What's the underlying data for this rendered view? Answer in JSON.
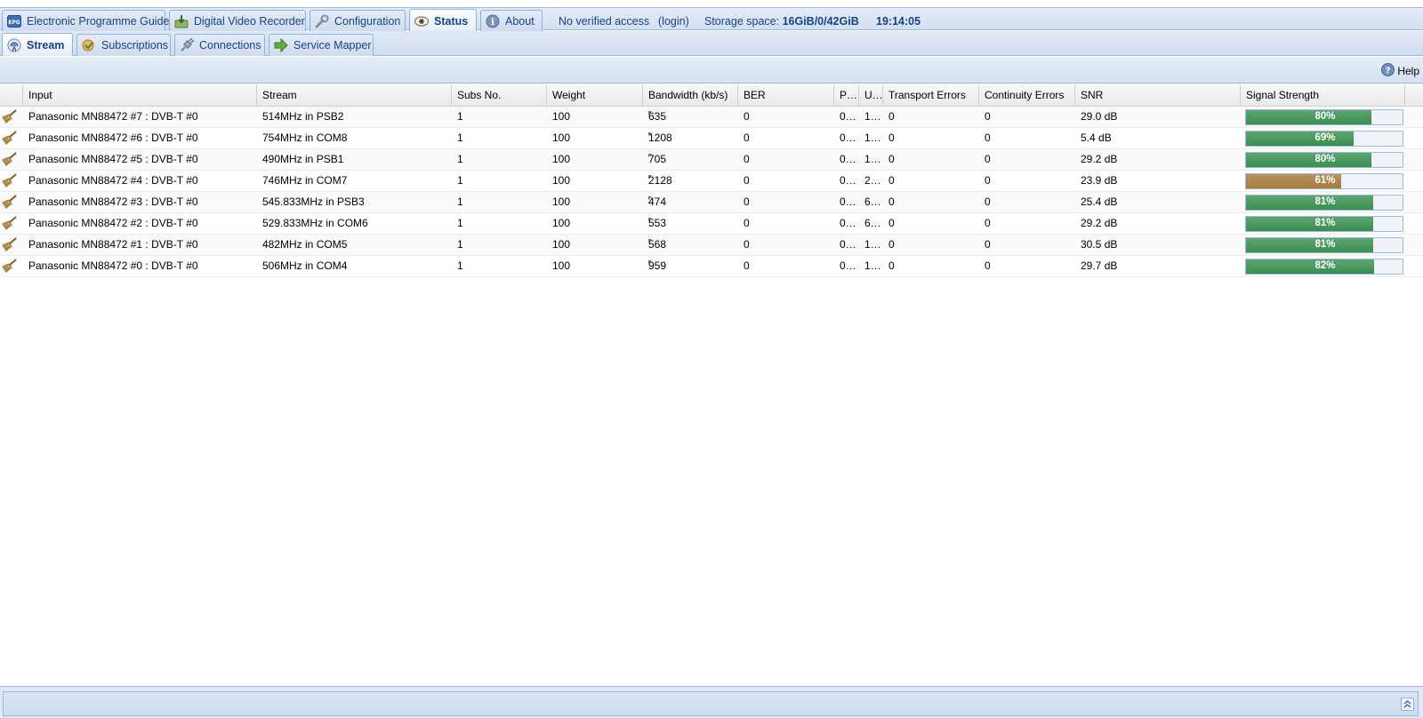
{
  "top_tabs": [
    {
      "label": "Electronic Programme Guide",
      "icon": "epg-icon",
      "active": false
    },
    {
      "label": "Digital Video Recorder",
      "icon": "dvr-icon",
      "active": false
    },
    {
      "label": "Configuration",
      "icon": "wrench-icon",
      "active": false
    },
    {
      "label": "Status",
      "icon": "eye-icon",
      "active": true
    },
    {
      "label": "About",
      "icon": "info-icon",
      "active": false
    }
  ],
  "header_info": {
    "access": "No verified access",
    "login": "(login)",
    "storage_label": "Storage space:",
    "storage_value": "16GiB/0/42GiB",
    "time": "19:14:05"
  },
  "sub_tabs": [
    {
      "label": "Stream",
      "icon": "antenna-icon",
      "active": true
    },
    {
      "label": "Subscriptions",
      "icon": "subscriptions-icon",
      "active": false
    },
    {
      "label": "Connections",
      "icon": "plug-icon",
      "active": false
    },
    {
      "label": "Service Mapper",
      "icon": "arrow-right-icon",
      "active": false
    }
  ],
  "toolbar": {
    "help_label": "Help"
  },
  "grid": {
    "columns": [
      "Input",
      "Stream",
      "Subs No.",
      "Weight",
      "Bandwidth (kb/s)",
      "BER",
      "P…",
      "U…",
      "Transport Errors",
      "Continuity Errors",
      "SNR",
      "Signal Strength"
    ],
    "rows": [
      {
        "input": "Panasonic MN88472 #7 : DVB-T #0",
        "stream": "514MHz in PSB2",
        "subs": "1",
        "weight": "100",
        "bandwidth": "635",
        "ber": "0",
        "p": "0…",
        "u": "1…",
        "transport": "0",
        "continuity": "0",
        "snr": "29.0 dB",
        "signal": 80,
        "signal_label": "80%",
        "signal_color": "#3a8f4f"
      },
      {
        "input": "Panasonic MN88472 #6 : DVB-T #0",
        "stream": "754MHz in COM8",
        "subs": "1",
        "weight": "100",
        "bandwidth": "1208",
        "ber": "0",
        "p": "0…",
        "u": "1…",
        "transport": "0",
        "continuity": "0",
        "snr": "5.4 dB",
        "signal": 69,
        "signal_label": "69%",
        "signal_color": "#3a8f4f"
      },
      {
        "input": "Panasonic MN88472 #5 : DVB-T #0",
        "stream": "490MHz in PSB1",
        "subs": "1",
        "weight": "100",
        "bandwidth": "705",
        "ber": "0",
        "p": "0…",
        "u": "1…",
        "transport": "0",
        "continuity": "0",
        "snr": "29.2 dB",
        "signal": 80,
        "signal_label": "80%",
        "signal_color": "#3a8f4f"
      },
      {
        "input": "Panasonic MN88472 #4 : DVB-T #0",
        "stream": "746MHz in COM7",
        "subs": "1",
        "weight": "100",
        "bandwidth": "2128",
        "ber": "0",
        "p": "0…",
        "u": "2…",
        "transport": "0",
        "continuity": "0",
        "snr": "23.9 dB",
        "signal": 61,
        "signal_label": "61%",
        "signal_color": "#a87a3c"
      },
      {
        "input": "Panasonic MN88472 #3 : DVB-T #0",
        "stream": "545.833MHz in PSB3",
        "subs": "1",
        "weight": "100",
        "bandwidth": "474",
        "ber": "0",
        "p": "0…",
        "u": "6…",
        "transport": "0",
        "continuity": "0",
        "snr": "25.4 dB",
        "signal": 81,
        "signal_label": "81%",
        "signal_color": "#3a8f4f"
      },
      {
        "input": "Panasonic MN88472 #2 : DVB-T #0",
        "stream": "529.833MHz in COM6",
        "subs": "1",
        "weight": "100",
        "bandwidth": "553",
        "ber": "0",
        "p": "0…",
        "u": "6…",
        "transport": "0",
        "continuity": "0",
        "snr": "29.2 dB",
        "signal": 81,
        "signal_label": "81%",
        "signal_color": "#3a8f4f"
      },
      {
        "input": "Panasonic MN88472 #1 : DVB-T #0",
        "stream": "482MHz in COM5",
        "subs": "1",
        "weight": "100",
        "bandwidth": "568",
        "ber": "0",
        "p": "0…",
        "u": "1…",
        "transport": "0",
        "continuity": "0",
        "snr": "30.5 dB",
        "signal": 81,
        "signal_label": "81%",
        "signal_color": "#3a8f4f"
      },
      {
        "input": "Panasonic MN88472 #0 : DVB-T #0",
        "stream": "506MHz in COM4",
        "subs": "1",
        "weight": "100",
        "bandwidth": "959",
        "ber": "0",
        "p": "0…",
        "u": "1…",
        "transport": "0",
        "continuity": "0",
        "snr": "29.7 dB",
        "signal": 82,
        "signal_label": "82%",
        "signal_color": "#3a8f4f"
      }
    ]
  },
  "colors": {
    "accent": "#15428b",
    "border": "#99bbe8",
    "signal_good": "#3a8f4f",
    "signal_warn": "#a87a3c"
  }
}
